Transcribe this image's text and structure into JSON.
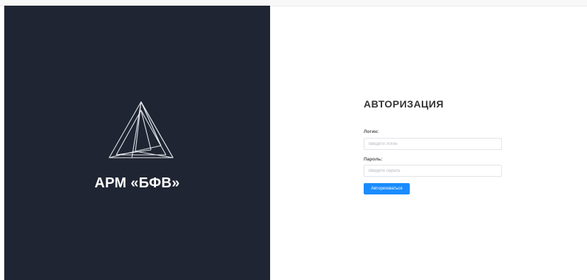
{
  "branding": {
    "app_title": "АРМ «БФВ»",
    "logo_icon": "triangle-logo-icon"
  },
  "auth": {
    "title": "АВТОРИЗАЦИЯ",
    "login_label": "Логин:",
    "login_placeholder": "Введите логин",
    "login_value": "",
    "password_label": "Пароль:",
    "password_placeholder": "Введите пароль",
    "password_value": "",
    "submit_label": "Авторизоваться"
  },
  "colors": {
    "left_panel_bg": "#1f2532",
    "accent": "#1a8cff",
    "title_text": "#333333"
  }
}
